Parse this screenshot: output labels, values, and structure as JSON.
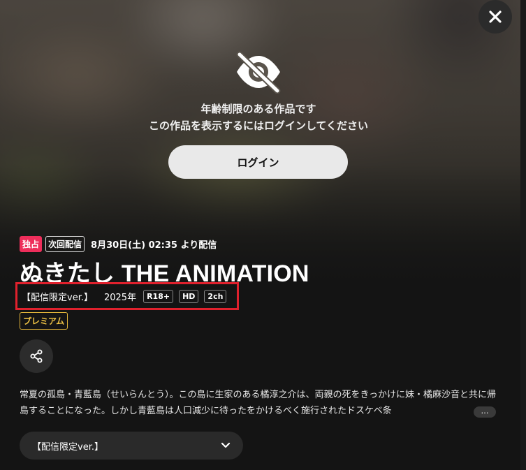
{
  "gate": {
    "message_line1": "年齢制限のある作品です",
    "message_line2": "この作品を表示するにはログインしてください",
    "login_label": "ログイン",
    "icon": "eye-slash-icon"
  },
  "close": {
    "icon": "close-icon"
  },
  "badges": {
    "exclusive": "独占",
    "next_delivery": "次回配信",
    "next_date": "8月30日(土) 02:35 より配信"
  },
  "title": "ぬきたし THE ANIMATION",
  "specs": {
    "version": "【配信限定ver.】",
    "year": "2025年",
    "rating": "R18+",
    "quality": "HD",
    "audio": "2ch"
  },
  "premium_label": "プレミアム",
  "share": {
    "icon": "share-icon"
  },
  "description": "常夏の孤島・青藍島（せいらんとう）。この島に生家のある橘淳之介は、両親の死をきっかけに妹・橘麻沙音と共に帰島することになった。しかし青藍島は人口減少に待ったをかけるべく施行されたドスケベ条",
  "more_label": "…",
  "version_select": {
    "selected": "【配信限定ver.】",
    "icon": "chevron-down-icon"
  },
  "colors": {
    "exclusive_red": "#ee2e5b",
    "premium_gold": "#f2c545",
    "highlight_red": "#e0212d",
    "background": "#141414"
  }
}
